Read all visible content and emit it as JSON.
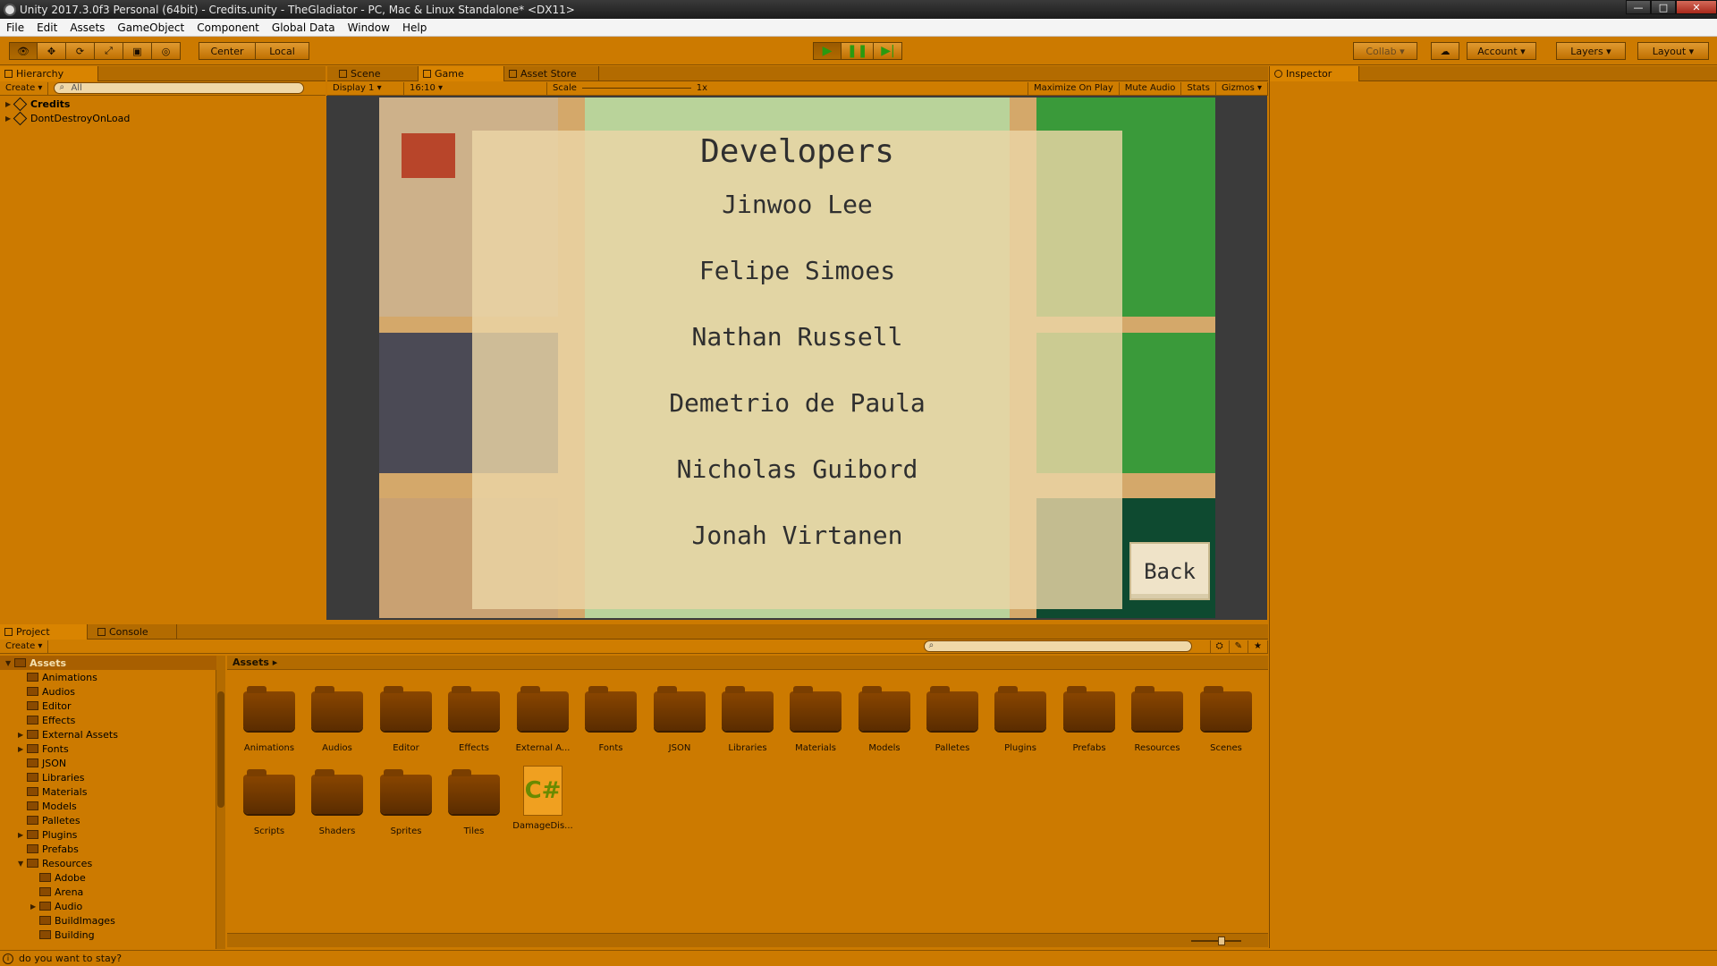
{
  "window": {
    "title": "Unity 2017.3.0f3 Personal (64bit) - Credits.unity - TheGladiator - PC, Mac & Linux Standalone* <DX11>",
    "minimize": "—",
    "maximize": "□",
    "close": "✕"
  },
  "menu": [
    "File",
    "Edit",
    "Assets",
    "GameObject",
    "Component",
    "Global Data",
    "Window",
    "Help"
  ],
  "toolbar": {
    "center_label": "Center",
    "local_label": "Local",
    "collab_label": "Collab",
    "account_label": "Account",
    "layers_label": "Layers",
    "layout_label": "Layout"
  },
  "hierarchy": {
    "tab_label": "Hierarchy",
    "create_label": "Create",
    "search_placeholder": "All",
    "items": [
      "Credits",
      "DontDestroyOnLoad"
    ]
  },
  "center_tabs": [
    "Scene",
    "Game",
    "Asset Store"
  ],
  "game_toolbar": {
    "display": "Display 1",
    "aspect": "16:10",
    "scale_label": "Scale",
    "scale_value": "1x",
    "maximize_on_play": "Maximize On Play",
    "mute_audio": "Mute Audio",
    "stats": "Stats",
    "gizmos": "Gizmos"
  },
  "game_view": {
    "title": "Developers",
    "names": [
      "Jinwoo Lee",
      "Felipe Simoes",
      "Nathan Russell",
      "Demetrio de Paula",
      "Nicholas Guibord",
      "Jonah Virtanen"
    ],
    "back_label": "Back"
  },
  "inspector": {
    "tab_label": "Inspector"
  },
  "project": {
    "tab_label": "Project",
    "console_label": "Console",
    "create_label": "Create",
    "breadcrumb": "Assets",
    "tree_root": "Assets",
    "tree": [
      "Animations",
      "Audios",
      "Editor",
      "Effects",
      "External Assets",
      "Fonts",
      "JSON",
      "Libraries",
      "Materials",
      "Models",
      "Palletes",
      "Plugins",
      "Prefabs",
      "Resources"
    ],
    "tree_sub": [
      "Adobe",
      "Arena",
      "Audio",
      "BuildImages",
      "Building"
    ],
    "assets_row1": [
      "Animations",
      "Audios",
      "Editor",
      "Effects",
      "External A...",
      "Fonts",
      "JSON",
      "Libraries",
      "Materials",
      "Models",
      "Palletes",
      "Plugins",
      "Prefabs",
      "Resources",
      "Scenes"
    ],
    "assets_row2": [
      "Scripts",
      "Shaders",
      "Sprites",
      "Tiles"
    ],
    "script_file": "DamageDis...",
    "script_glyph": "C#"
  },
  "status": {
    "message": "do you want to stay?"
  },
  "colors": {
    "editor_bg": "#cc7a00",
    "tab_header": "#b36b00",
    "overlay": "#ecd6a6",
    "grass": "#3a9a3a",
    "road": "#d4a86a"
  }
}
